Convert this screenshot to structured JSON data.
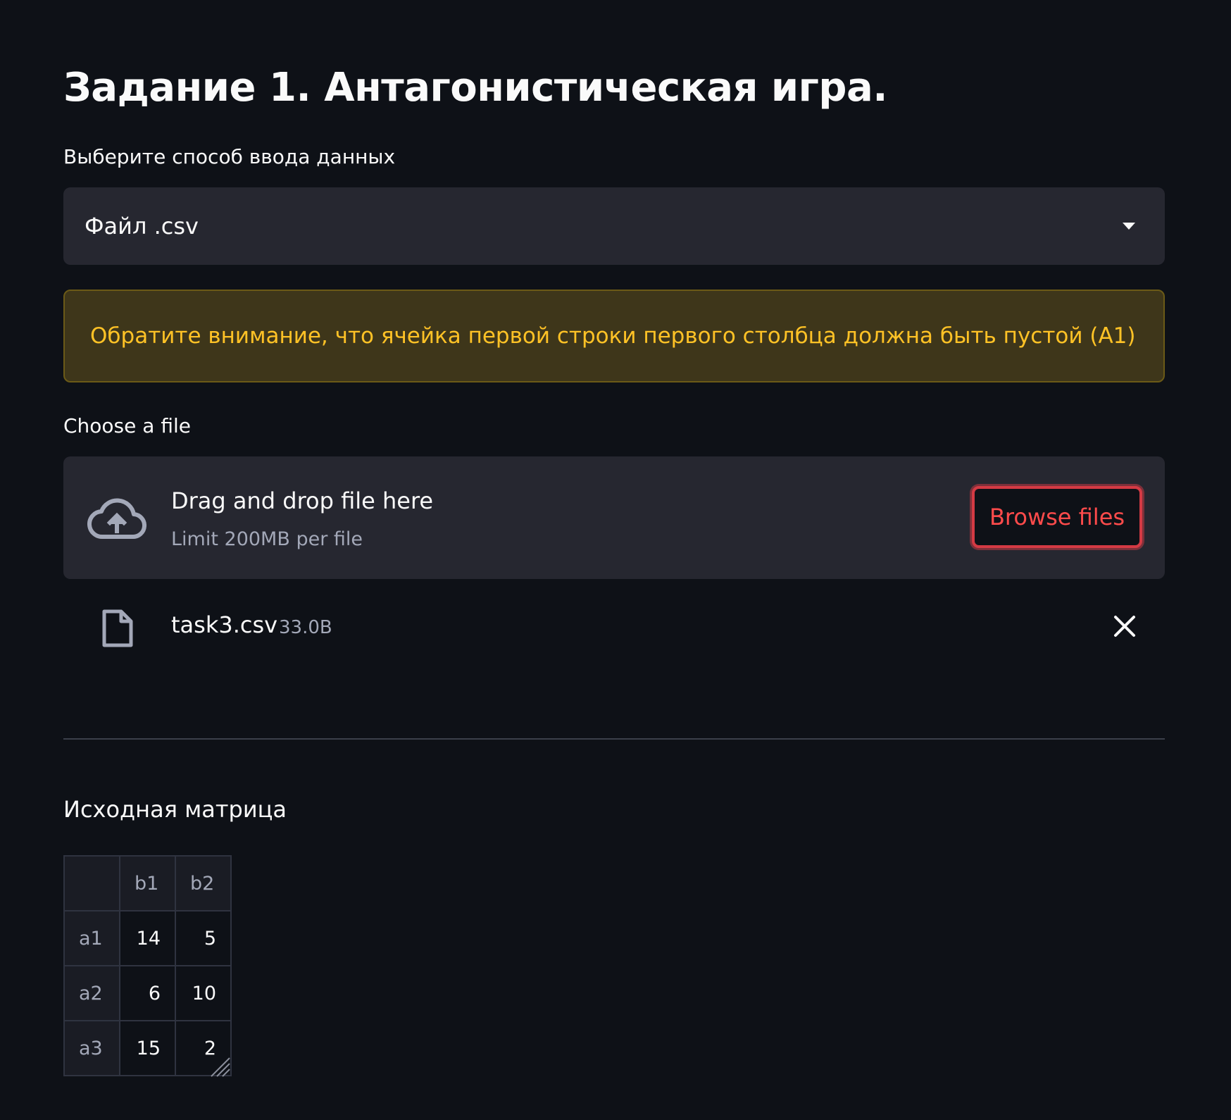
{
  "page_title": "Задание 1. Антагонистическая игра.",
  "input_method": {
    "label": "Выберите способ ввода данных",
    "selected": "Файл .csv"
  },
  "warning": {
    "text": "Обратите внимание, что ячейка первой строки первого столбца должна быть пустой (A1)"
  },
  "uploader": {
    "label": "Choose a file",
    "drop_text": "Drag and drop file here",
    "limit_text": "Limit 200MB per file",
    "browse_label": "Browse files"
  },
  "uploaded_file": {
    "name": "task3.csv",
    "size": "33.0B"
  },
  "matrix": {
    "title": "Исходная матрица",
    "columns": [
      "b1",
      "b2"
    ],
    "rows": [
      {
        "label": "a1",
        "values": [
          "14",
          "5"
        ]
      },
      {
        "label": "a2",
        "values": [
          "6",
          "10"
        ]
      },
      {
        "label": "a3",
        "values": [
          "15",
          "2"
        ]
      }
    ]
  },
  "icons": {
    "upload": "cloud-upload-icon",
    "file": "file-icon",
    "remove": "close-icon",
    "dropdown": "chevron-down-icon"
  },
  "colors": {
    "background": "#0e1117",
    "panel": "#262730",
    "warning_bg": "#3e361a",
    "warning_text": "#ffc226",
    "accent": "#ff4b4b"
  }
}
